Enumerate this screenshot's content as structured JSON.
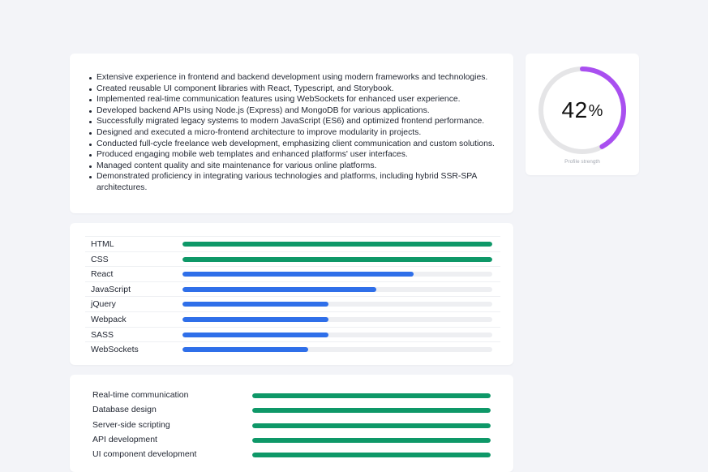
{
  "summary": {
    "bullets": [
      "Extensive experience in frontend and backend development using modern frameworks and technologies.",
      "Created reusable UI component libraries with React, Typescript, and Storybook.",
      "Implemented real-time communication features using WebSockets for enhanced user experience.",
      "Developed backend APIs using Node.js (Express) and MongoDB for various applications.",
      "Successfully migrated legacy systems to modern JavaScript (ES6) and optimized frontend performance.",
      "Designed and executed a micro-frontend architecture to improve modularity in projects.",
      "Conducted full-cycle freelance web development, emphasizing client communication and custom solutions.",
      "Produced engaging mobile web templates and enhanced platforms' user interfaces.",
      "Managed content quality and site maintenance for various online platforms.",
      "Demonstrated proficiency in integrating various technologies and platforms, including hybrid SSR-SPA architectures."
    ]
  },
  "profile_strength": {
    "value": "42",
    "unit": "%",
    "percent": 42,
    "label": "Profile strength",
    "ring_color": "#a94ff0",
    "track_color": "#e5e5e7"
  },
  "skills": {
    "items": [
      {
        "name": "HTML",
        "level": 1.0,
        "color": "#0e9868"
      },
      {
        "name": "CSS",
        "level": 1.0,
        "color": "#0e9868"
      },
      {
        "name": "React",
        "level": 0.745,
        "color": "#2f6fe9"
      },
      {
        "name": "JavaScript",
        "level": 0.625,
        "color": "#2f6fe9"
      },
      {
        "name": "jQuery",
        "level": 0.47,
        "color": "#2f6fe9"
      },
      {
        "name": "Webpack",
        "level": 0.47,
        "color": "#2f6fe9"
      },
      {
        "name": "SASS",
        "level": 0.47,
        "color": "#2f6fe9"
      },
      {
        "name": "WebSockets",
        "level": 0.405,
        "color": "#2f6fe9"
      }
    ]
  },
  "areas": {
    "items": [
      {
        "name": "Real-time communication",
        "level": 1.0,
        "color": "#0e9868"
      },
      {
        "name": "Database design",
        "level": 1.0,
        "color": "#0e9868"
      },
      {
        "name": "Server-side scripting",
        "level": 1.0,
        "color": "#0e9868"
      },
      {
        "name": "API development",
        "level": 1.0,
        "color": "#0e9868"
      },
      {
        "name": "UI component development",
        "level": 1.0,
        "color": "#0e9868"
      }
    ]
  }
}
